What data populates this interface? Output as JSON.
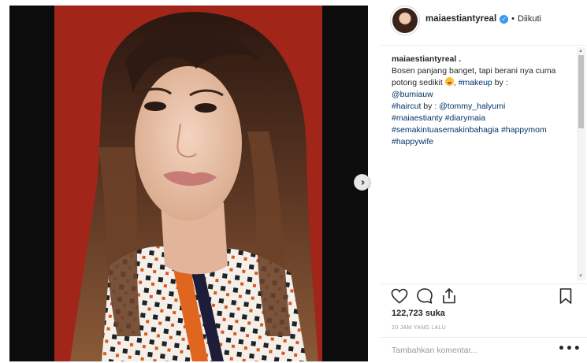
{
  "post": {
    "username": "maiaestiantyreal",
    "follow_status": "Diikuti",
    "separator": "•",
    "verified_glyph": "✓",
    "next_glyph": "›"
  },
  "caption": {
    "author": "maiaestiantyreal .",
    "line1": "Bosen panjang banget, tapi berani nya cuma potong sedikit",
    "tag_makeup": "#makeup",
    "by1": " by :",
    "mention_makeup": "@bumiauw",
    "tag_haircut": "#haircut",
    "by2": " by : ",
    "mention_haircut": "@tommy_halyumi",
    "tag_maia": "#maiaestianty",
    "tag_diary": "#diarymaia",
    "tag_semakin": "#semakintuasemakinbahagia",
    "tag_happymom": "#happymom",
    "tag_happywife": "#happywife"
  },
  "engagement": {
    "likes": "122,723 suka",
    "timestamp": "20 JAM YANG LALU"
  },
  "comment": {
    "placeholder": "Tambahkan komentar...",
    "more": "•••"
  },
  "scroll": {
    "up": "▲",
    "down": "▼"
  },
  "icons": {
    "like": "heart-icon",
    "comment": "comment-bubble-icon",
    "share": "share-icon",
    "save": "bookmark-icon",
    "next": "chevron-right-icon",
    "verified": "verified-badge-icon"
  },
  "colors": {
    "photo_background": "#a8271b",
    "link": "#003569",
    "verified": "#3897f0",
    "muted": "#999999"
  }
}
